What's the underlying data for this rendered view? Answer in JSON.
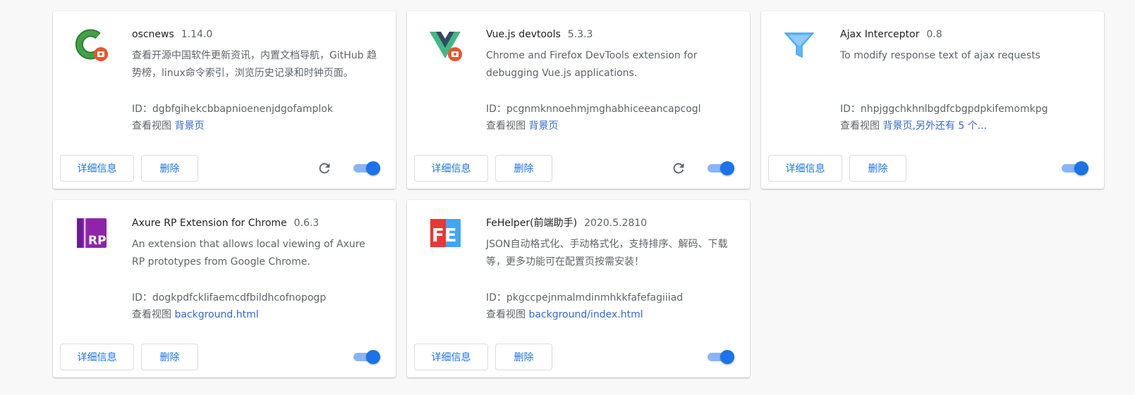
{
  "labels": {
    "id_prefix": "ID：",
    "inspect_views": "查看视图",
    "details_button": "详细信息",
    "remove_button": "删除"
  },
  "colors": {
    "link": "#3367d6",
    "toggle_on_knob": "#1a73e8",
    "toggle_on_track": "#8ab4f8",
    "button_text": "#1a73e8"
  },
  "extensions": [
    {
      "name": "oscnews",
      "version": "1.14.0",
      "description": "查看开源中国软件更新资讯，内置文档导航，GitHub 趋势榜，linux命令索引，浏览历史记录和时钟页面。",
      "id": "dgbfgihekcbbapnioenenjdgofamplok",
      "views_link": "背景页",
      "icon": "oscnews-logo-icon",
      "enabled": true,
      "reload": true
    },
    {
      "name": "Vue.js devtools",
      "version": "5.3.3",
      "description": "Chrome and Firefox DevTools extension for debugging Vue.js applications.",
      "id": "pcgnmknnoehmjmghabhiceeancapcogl",
      "views_link": "背景页",
      "icon": "vue-logo-icon",
      "enabled": true,
      "reload": true
    },
    {
      "name": "Ajax Interceptor",
      "version": "0.8",
      "description": "To modify response text of ajax requests",
      "id": "nhpjggchkhnlbgdfcbgpdpkifemomkpg",
      "views_link": "背景页,另外还有 5 个...",
      "icon": "funnel-icon",
      "enabled": true,
      "reload": false
    },
    {
      "name": "Axure RP Extension for Chrome",
      "version": "0.6.3",
      "description": "An extension that allows local viewing of Axure RP prototypes from Google Chrome.",
      "id": "dogkpdfcklifaemcdfbildhcofnopogp",
      "views_link": "background.html",
      "icon": "axure-rp-logo-icon",
      "enabled": true,
      "reload": false
    },
    {
      "name": "FeHelper(前端助手)",
      "version": "2020.5.2810",
      "description": "JSON自动格式化、手动格式化，支持排序、解码、下载等，更多功能可在配置页按需安装！",
      "id": "pkgccpejnmalmdinmhkkfafefagiiiad",
      "views_link": "background/index.html",
      "icon": "fehelper-logo-icon",
      "enabled": true,
      "reload": false
    }
  ]
}
